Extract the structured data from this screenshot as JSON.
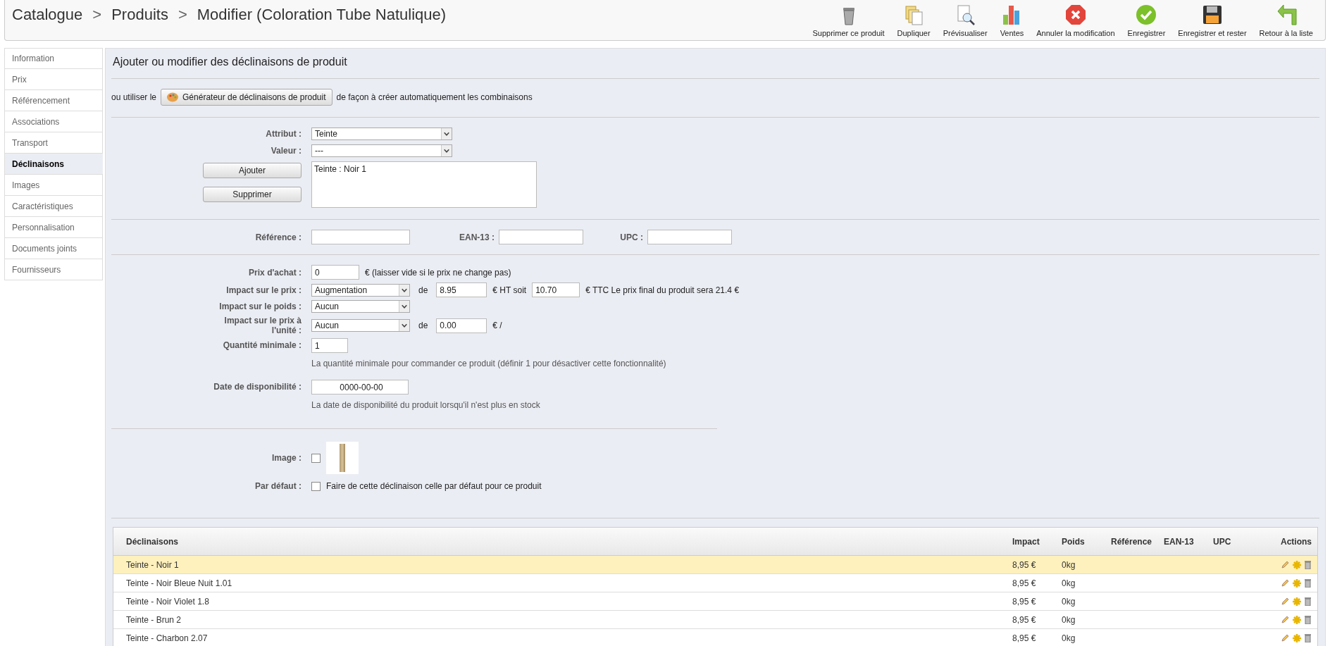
{
  "breadcrumb": [
    {
      "kind": "link",
      "text": "Catalogue"
    },
    {
      "kind": "separator",
      "text": ">"
    },
    {
      "kind": "link",
      "text": "Produits"
    },
    {
      "kind": "separator",
      "text": ">"
    },
    {
      "kind": "current",
      "text": "Modifier (Coloration Tube Natulique)"
    }
  ],
  "toolbar": [
    {
      "kind": "trash",
      "label": "Supprimer ce produit"
    },
    {
      "kind": "duplicate",
      "label": "Dupliquer"
    },
    {
      "kind": "preview",
      "label": "Prévisualiser"
    },
    {
      "kind": "chart",
      "label": "Ventes"
    },
    {
      "kind": "cancel",
      "label": "Annuler la modification"
    },
    {
      "kind": "check",
      "label": "Enregistrer"
    },
    {
      "kind": "disk",
      "label": "Enregistrer et rester"
    },
    {
      "kind": "back",
      "label": "Retour à la liste"
    }
  ],
  "sidebar": {
    "items": [
      {
        "label": "Information",
        "selected": false
      },
      {
        "label": "Prix",
        "selected": false
      },
      {
        "label": "Référencement",
        "selected": false
      },
      {
        "label": "Associations",
        "selected": false
      },
      {
        "label": "Transport",
        "selected": false
      },
      {
        "label": "Déclinaisons",
        "selected": true
      },
      {
        "label": "Images",
        "selected": false
      },
      {
        "label": "Caractéristiques",
        "selected": false
      },
      {
        "label": "Personnalisation",
        "selected": false
      },
      {
        "label": "Documents joints",
        "selected": false
      },
      {
        "label": "Fournisseurs",
        "selected": false
      }
    ]
  },
  "section_title": "Ajouter ou modifier des déclinaisons de produit",
  "generator": {
    "prefix": "ou utiliser le",
    "button": "Générateur de déclinaisons de produit",
    "suffix": "de façon à créer automatiquement les combinaisons"
  },
  "attributes": {
    "attribute_label": "Attribut :",
    "attribute_value": "Teinte",
    "value_label": "Valeur :",
    "value_value": "---",
    "add_button": "Ajouter",
    "remove_button": "Supprimer",
    "selected_list": [
      "Teinte : Noir 1"
    ]
  },
  "codes": [
    {
      "label": "Référence :"
    },
    {
      "label": "EAN-13 :"
    },
    {
      "label": "UPC :"
    }
  ],
  "pricing": [
    {
      "kind": "input",
      "label": "Prix d'achat :",
      "value": "0",
      "after": "€ (laisser vide si le prix ne change pas)"
    },
    {
      "kind": "impact",
      "label": "Impact sur le prix :",
      "select": "Augmentation",
      "de": "de",
      "amount": "8.95",
      "mid": "€ HT soit",
      "amount2": "10.70",
      "after": "€ TTC Le prix final du produit sera 21.4 €"
    },
    {
      "kind": "select",
      "label": "Impact sur le poids :",
      "select": "Aucun"
    },
    {
      "kind": "impact",
      "label": "Impact sur le prix à l'unité :",
      "select": "Aucun",
      "de": "de",
      "amount": "0.00",
      "mid": "€ /"
    },
    {
      "kind": "help",
      "label": "Quantité minimale :",
      "value": "1",
      "help": "La quantité minimale pour commander ce produit (définir 1 pour désactiver cette fonctionnalité)"
    },
    {
      "kind": "date",
      "label": "Date de disponibilité :",
      "value": "0000-00-00",
      "help": "La date de disponibilité du produit lorsqu'il n'est plus en stock"
    }
  ],
  "image": {
    "label": "Image :",
    "checked": false
  },
  "default": {
    "label": "Par défaut :",
    "checked": false,
    "text": "Faire de cette déclinaison celle par défaut pour ce produit"
  },
  "table": {
    "columns": [
      "Déclinaisons",
      "Impact",
      "Poids",
      "Référence",
      "EAN-13",
      "UPC",
      "Actions"
    ],
    "rows": [
      {
        "name": "Teinte - Noir 1",
        "impact": "8,95 €",
        "weight": "0kg",
        "selected": true
      },
      {
        "name": "Teinte - Noir Bleue Nuit 1.01",
        "impact": "8,95 €",
        "weight": "0kg",
        "selected": false
      },
      {
        "name": "Teinte - Noir Violet 1.8",
        "impact": "8,95 €",
        "weight": "0kg",
        "selected": false
      },
      {
        "name": "Teinte - Brun 2",
        "impact": "8,95 €",
        "weight": "0kg",
        "selected": false
      },
      {
        "name": "Teinte - Charbon 2.07",
        "impact": "8,95 €",
        "weight": "0kg",
        "selected": false
      }
    ]
  }
}
